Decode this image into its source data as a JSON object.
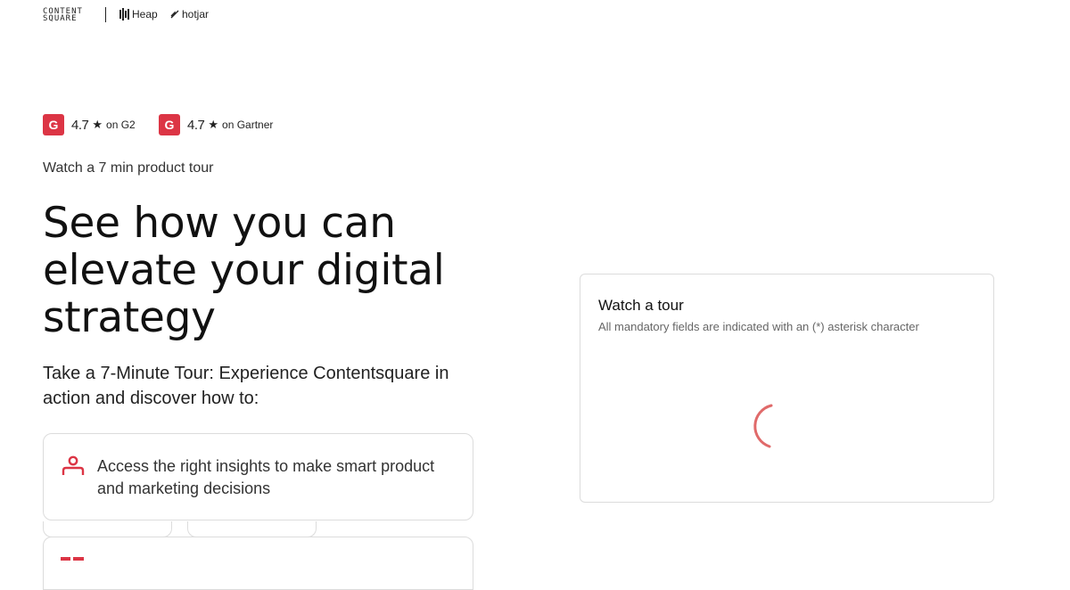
{
  "header": {
    "logos": {
      "contentsquare_line1": "CONTENT",
      "contentsquare_line2": "SQUARE",
      "heap": "Heap",
      "hotjar": "hotjar"
    }
  },
  "ratings": [
    {
      "badge": "G",
      "score": "4.7",
      "star": "★",
      "source": "on G2"
    },
    {
      "badge": "G",
      "score": "4.7",
      "star": "★",
      "source": "on Gartner"
    }
  ],
  "tour_label": "Watch a 7 min product tour",
  "hero": {
    "title": "See how you can elevate your digital strategy",
    "intro": "Take a 7-Minute Tour: Experience Contentsquare in action and discover how to:"
  },
  "benefits": [
    {
      "text": "Access the right insights to make smart product and marketing decisions",
      "icon": "user-icon"
    }
  ],
  "form": {
    "title": "Watch a tour",
    "note": "All mandatory fields are indicated with an (*) asterisk character",
    "status": "loading"
  },
  "colors": {
    "accent": "#dc3545",
    "border": "#dcdcdc",
    "text": "#1a1a1a",
    "muted": "#666666"
  }
}
